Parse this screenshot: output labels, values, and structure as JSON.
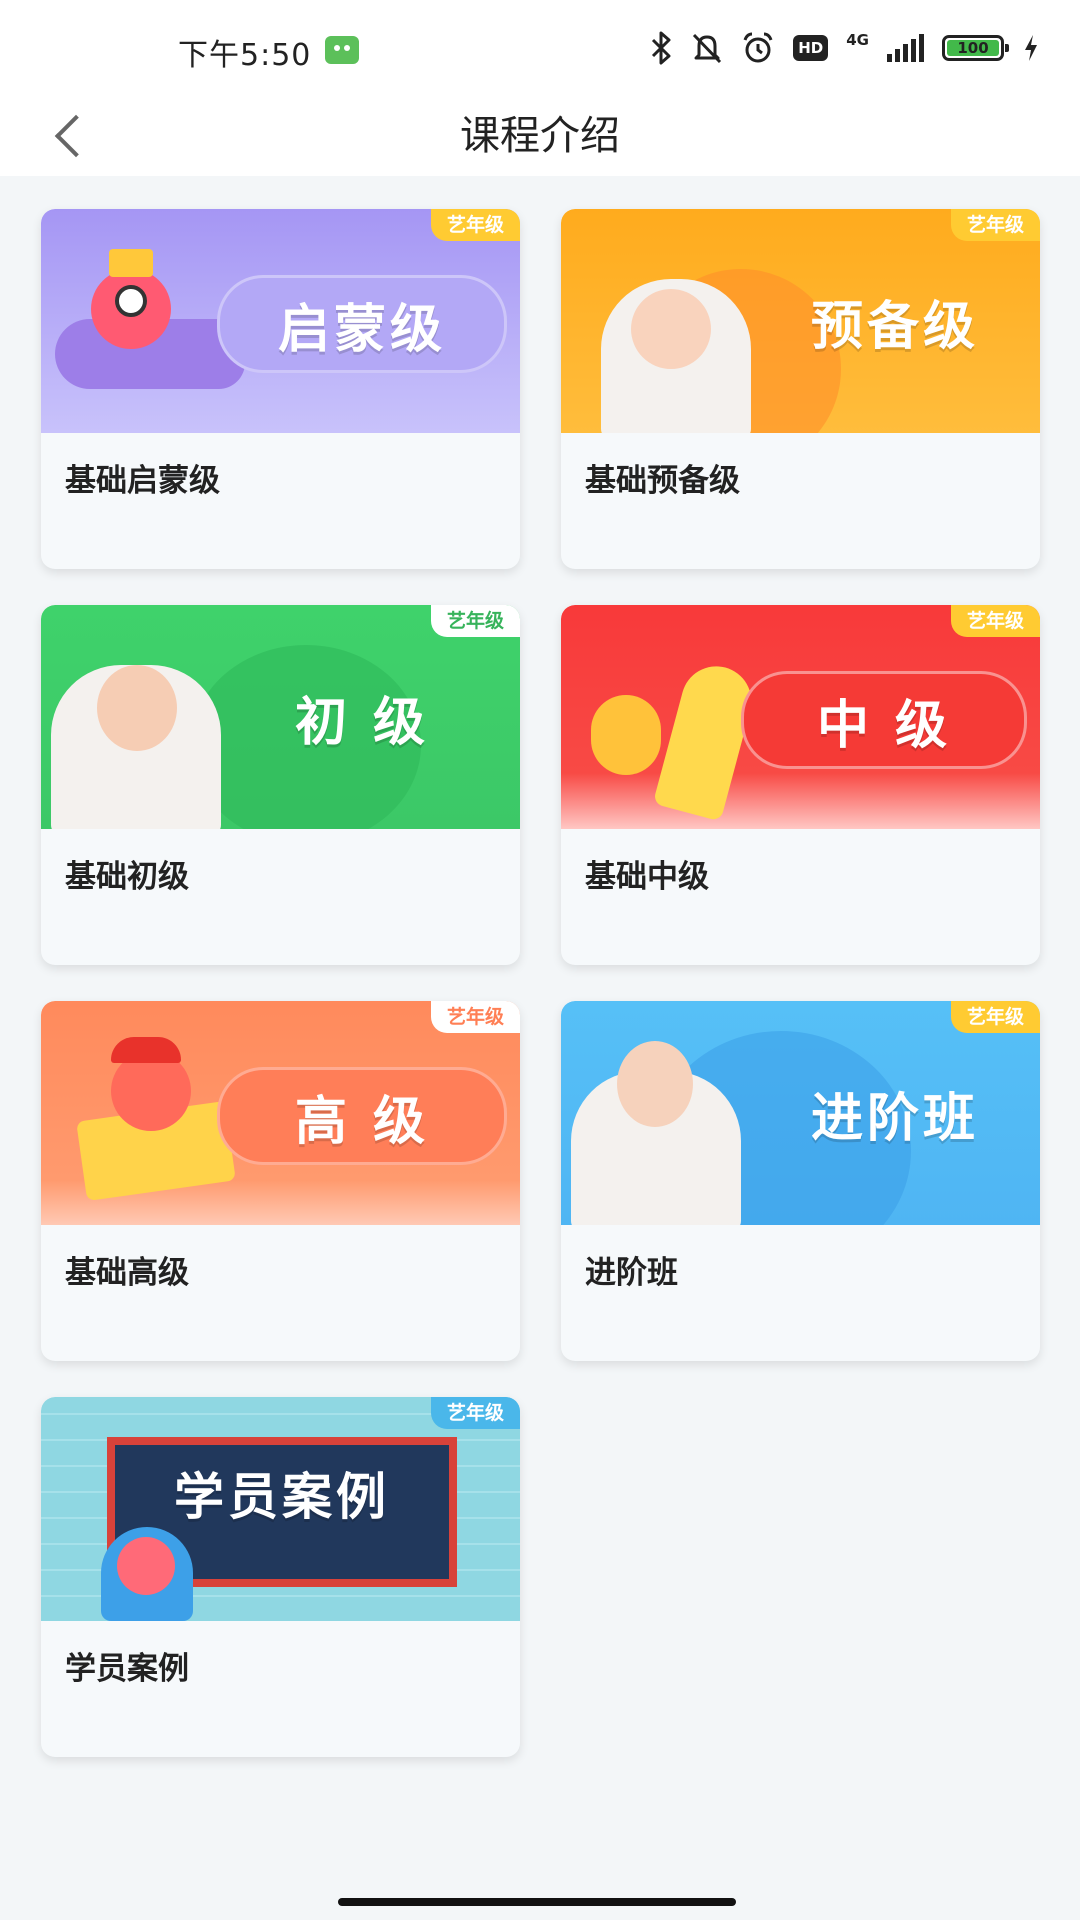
{
  "status_bar": {
    "time": "下午5:50",
    "network": "4G",
    "hd": "HD",
    "battery": "100"
  },
  "nav": {
    "title": "课程介绍"
  },
  "tag_text": "艺年级",
  "courses": [
    {
      "banner_text": "启蒙级",
      "label": "基础启蒙级",
      "color": "#a99bf2"
    },
    {
      "banner_text": "预备级",
      "label": "基础预备级",
      "color": "#ffb12b"
    },
    {
      "banner_text": "初 级",
      "label": "基础初级",
      "color": "#3fcf6c"
    },
    {
      "banner_text": "中 级",
      "label": "基础中级",
      "color": "#f63f3a"
    },
    {
      "banner_text": "高 级",
      "label": "基础高级",
      "color": "#ff8b60"
    },
    {
      "banner_text": "进阶班",
      "label": "进阶班",
      "color": "#4fb8f4"
    },
    {
      "banner_text": "学员案例",
      "label": "学员案例",
      "color": "#7fd2df"
    }
  ]
}
